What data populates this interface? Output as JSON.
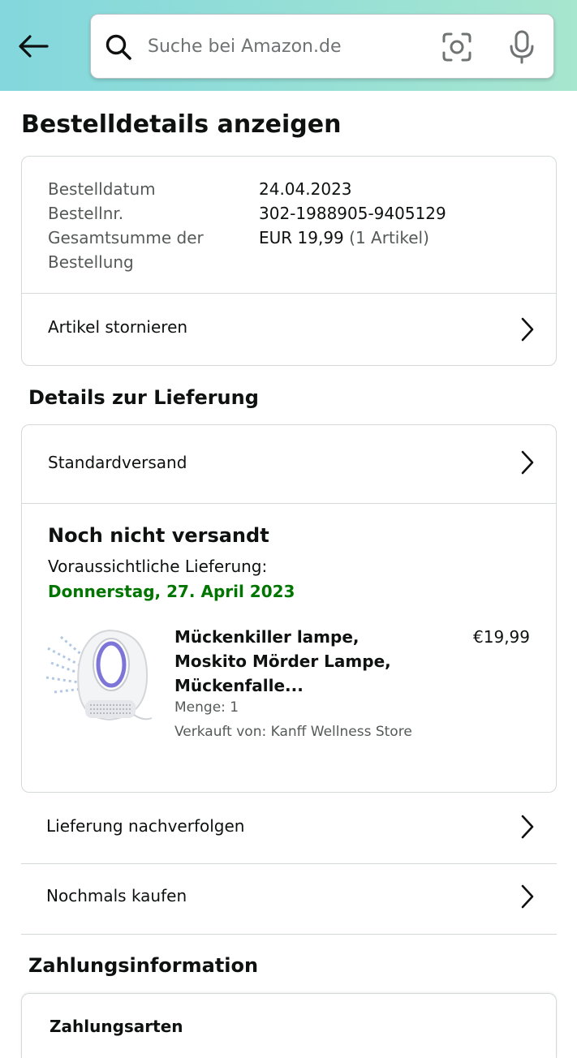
{
  "header": {
    "search_placeholder": "Suche bei Amazon.de",
    "icons": [
      "back-arrow-icon",
      "search-icon",
      "camera-scan-icon",
      "microphone-icon"
    ],
    "gradient_colors": [
      "#83d7dd",
      "#a7e6cf"
    ]
  },
  "page": {
    "title": "Bestelldetails anzeigen"
  },
  "summary": {
    "rows": [
      {
        "label": "Bestelldatum",
        "value": "24.04.2023"
      },
      {
        "label": "Bestellnr.",
        "value": "302-1988905-9405129"
      },
      {
        "label": "Gesamtsumme der Bestellung",
        "value": "EUR 19,99",
        "note": "(1 Artikel)"
      }
    ],
    "cancel_label": "Artikel stornieren"
  },
  "delivery": {
    "heading": "Details zur Lieferung",
    "shipping_method": "Standardversand",
    "status": "Noch nicht versandt",
    "eta_label": "Voraussichtliche Lieferung:",
    "eta_date": "Donnerstag, 27. April 2023",
    "eta_color": "#007600",
    "item": {
      "title": "Mückenkiller lampe, Moskito Mörder Lampe, Mückenfalle...",
      "price": "€19,99",
      "quantity": "Menge: 1",
      "seller": "Verkauft von: Kanff Wellness Store"
    },
    "track_label": "Lieferung nachverfolgen",
    "buy_again_label": "Nochmals kaufen"
  },
  "payment": {
    "heading": "Zahlungsinformation",
    "methods_title": "Zahlungsarten"
  }
}
